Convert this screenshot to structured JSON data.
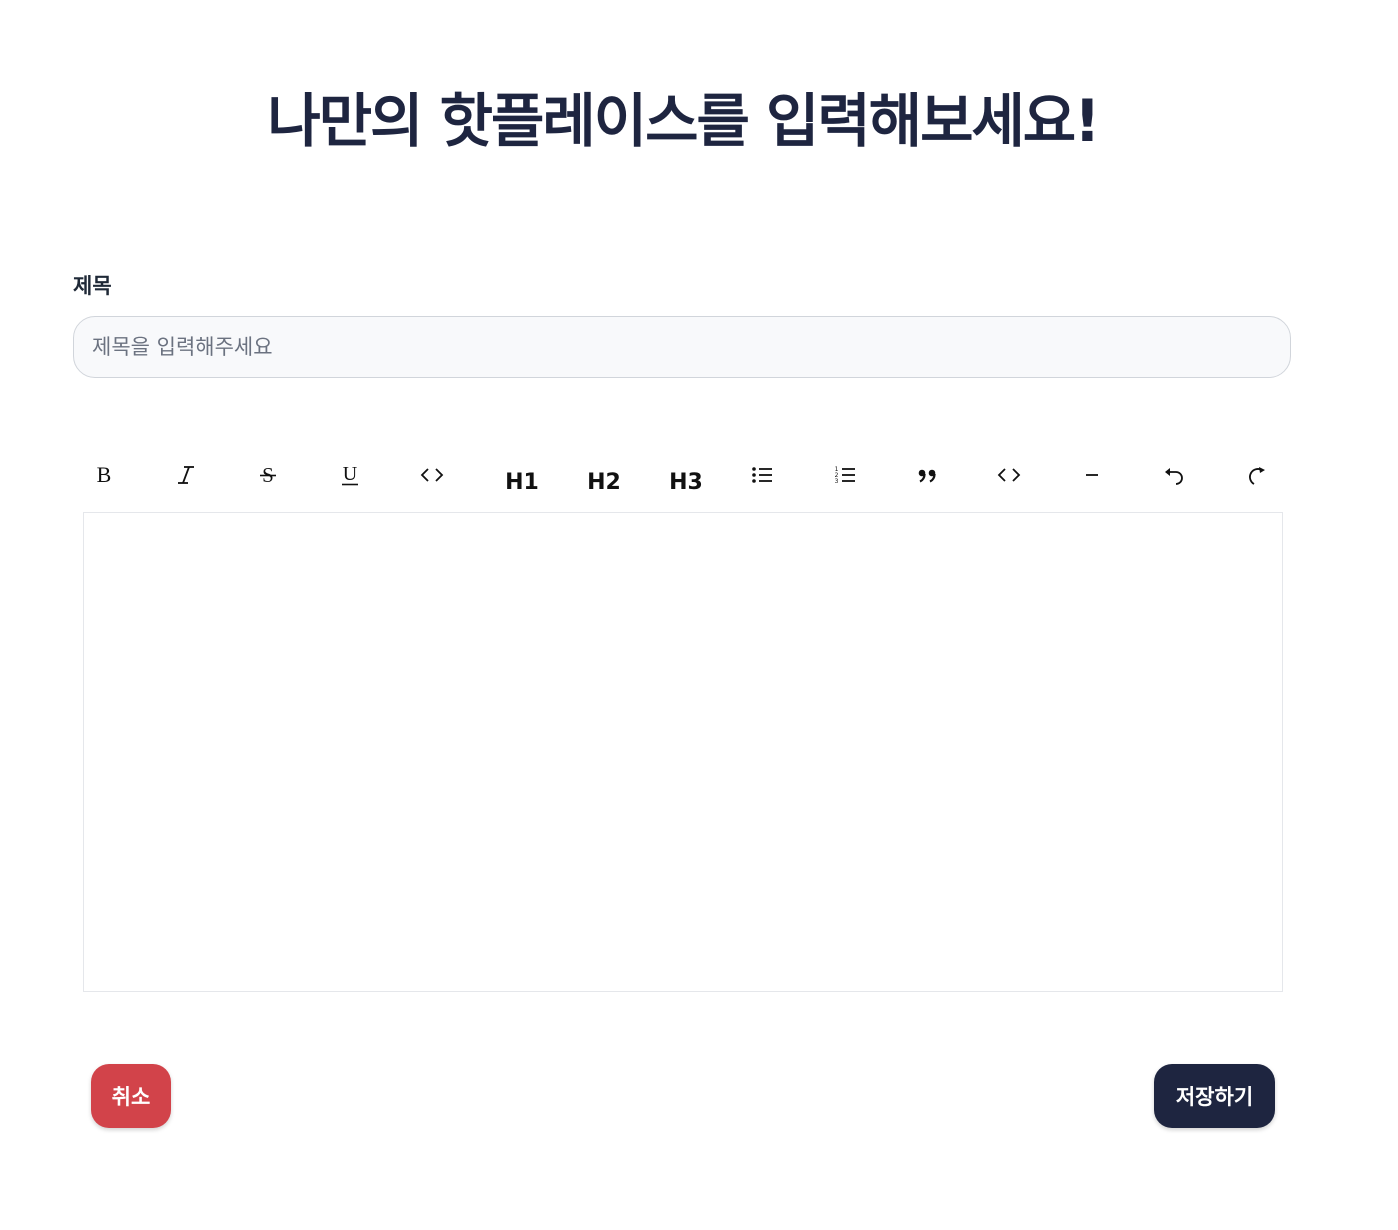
{
  "header": {
    "title": "나만의 핫플레이스를 입력해보세요!"
  },
  "form": {
    "title_label": "제목",
    "title_placeholder": "제목을 입력해주세요",
    "title_value": ""
  },
  "toolbar": {
    "items": [
      {
        "name": "bold",
        "icon": "bold-icon"
      },
      {
        "name": "italic",
        "icon": "italic-icon"
      },
      {
        "name": "strike",
        "icon": "strikethrough-icon"
      },
      {
        "name": "underline",
        "icon": "underline-icon"
      },
      {
        "name": "code",
        "icon": "code-icon"
      },
      {
        "name": "heading-1",
        "label": "H1"
      },
      {
        "name": "heading-2",
        "label": "H2"
      },
      {
        "name": "heading-3",
        "label": "H3"
      },
      {
        "name": "bullet-list",
        "icon": "bullet-list-icon"
      },
      {
        "name": "ordered-list",
        "icon": "ordered-list-icon"
      },
      {
        "name": "blockquote",
        "icon": "quote-icon"
      },
      {
        "name": "code-block",
        "icon": "code-block-icon"
      },
      {
        "name": "horizontal-rule",
        "icon": "horizontal-rule-icon"
      },
      {
        "name": "undo",
        "icon": "undo-icon"
      },
      {
        "name": "redo",
        "icon": "redo-icon"
      }
    ]
  },
  "editor": {
    "content": ""
  },
  "actions": {
    "cancel_label": "취소",
    "save_label": "저장하기"
  },
  "colors": {
    "title_text": "#1e2540",
    "cancel_button": "#d2434a",
    "save_button": "#1e2540",
    "input_background": "#f8f9fb",
    "input_border": "#d1d5db"
  }
}
